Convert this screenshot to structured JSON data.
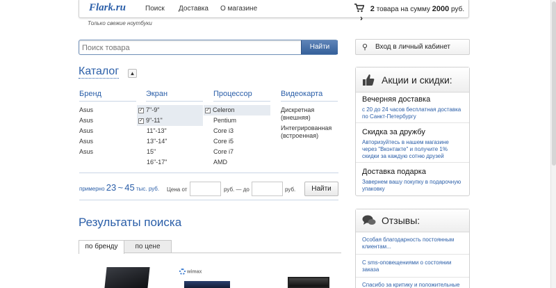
{
  "header": {
    "logo": "Flark.ru",
    "nav": [
      "Поиск",
      "Доставка",
      "О магазине"
    ],
    "cart": {
      "count": "2",
      "text_before": "товара на сумму",
      "sum": "2000",
      "currency": "руб."
    },
    "tagline": "Только свежие ноутбуки"
  },
  "search": {
    "placeholder": "Поиск товара",
    "button": "Найти"
  },
  "login": {
    "label": "Вход в личный кабинет"
  },
  "catalog": {
    "title": "Каталог",
    "columns": {
      "brand": {
        "header": "Бренд",
        "items": [
          "Asus",
          "Asus",
          "Asus",
          "Asus",
          "Asus"
        ]
      },
      "screen": {
        "header": "Экран",
        "items": [
          "7\"-9\"",
          "9\"-11\"",
          "11\"-13\"",
          "13\"-14\"",
          "15\"",
          "16\"-17\""
        ]
      },
      "cpu": {
        "header": "Процессор",
        "items": [
          "Celeron",
          "Pentium",
          "Core i3",
          "Core i5",
          "Core i7",
          "AMD"
        ]
      },
      "gpu": {
        "header": "Видеокарта",
        "items": [
          "Дискретная (внешняя)",
          "Интегрированная (встроенная)"
        ]
      }
    },
    "price": {
      "prefix": "примерно",
      "from": "23",
      "tilde": "~",
      "to": "45",
      "unit": "тыс. руб.",
      "label_from": "Цена от",
      "mid": "руб. — до",
      "suffix": "руб.",
      "button": "Найти"
    }
  },
  "results": {
    "title": "Результаты поиска",
    "tabs": [
      "по бренду",
      "по цене"
    ]
  },
  "promo": {
    "title": "Акции и скидки:",
    "items": [
      {
        "title": "Вечерняя доставка",
        "text": "с 20 до 24 часов бесплатная доставка по Санкт-Петербургу"
      },
      {
        "title": "Скидка за дружбу",
        "text": "Авторизуйтесь в нашем магазине через \"Вконтакте\" и получите 1% скидки за каждую сотню друзей"
      },
      {
        "title": "Доставка подарка",
        "text": "Завернем вашу покупку в подарочную упаковку"
      }
    ]
  },
  "reviews": {
    "title": "Отзывы:",
    "items": [
      "Особая благодарность постоянным клиентам...",
      "С sms-оповещениями о состоянии заказа",
      "Спасибо за критику и положительные"
    ]
  },
  "product_badge": "wimax"
}
